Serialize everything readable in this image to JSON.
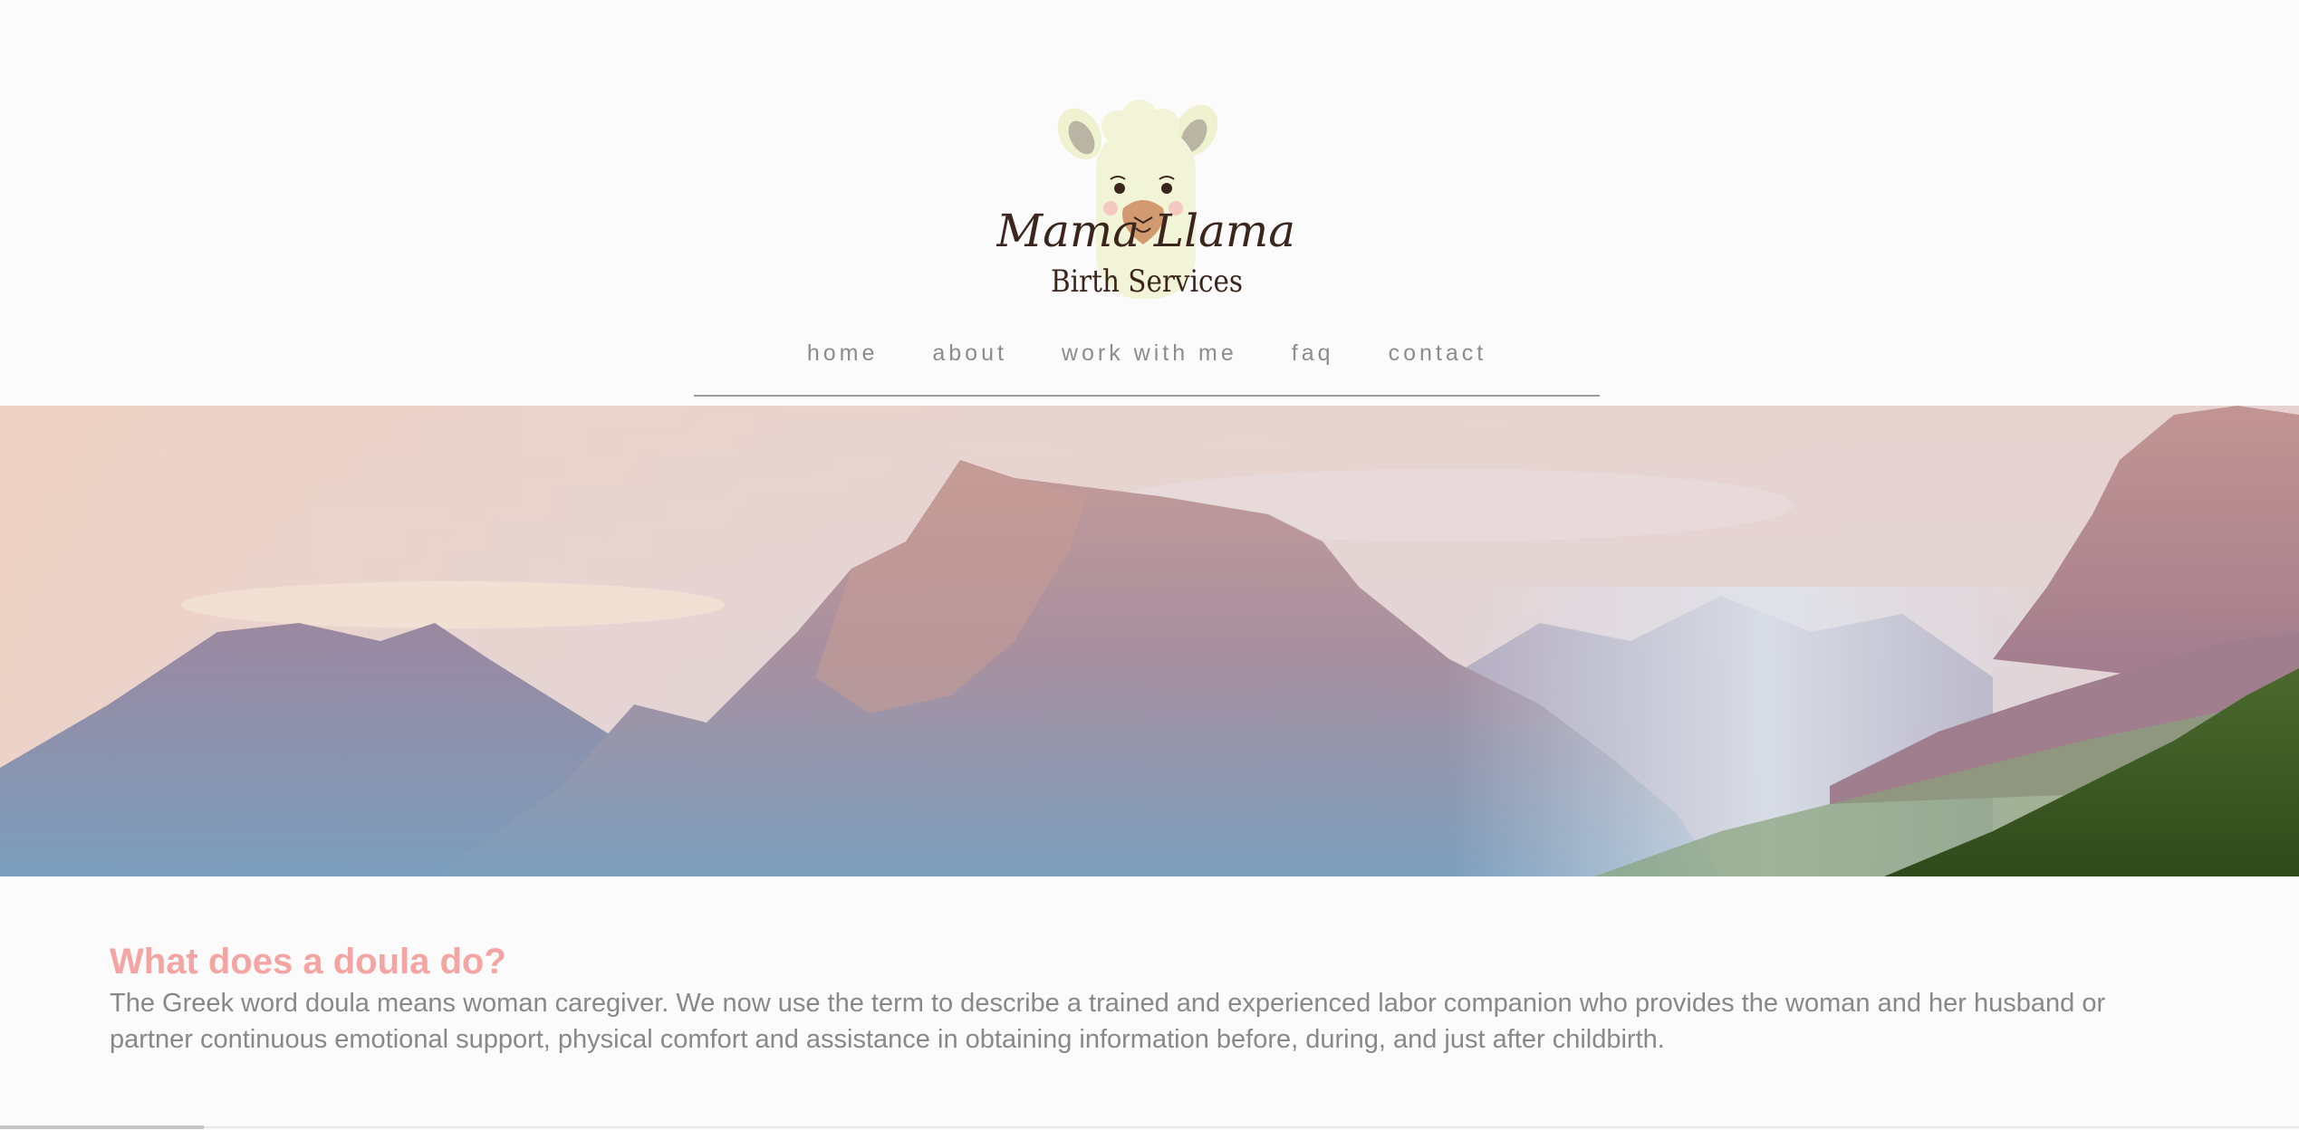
{
  "brand": {
    "line1": "Mama Llama",
    "line2": "Birth Services"
  },
  "nav": {
    "items": [
      {
        "label": "home"
      },
      {
        "label": "about"
      },
      {
        "label": "work with me"
      },
      {
        "label": "faq"
      },
      {
        "label": "contact"
      }
    ]
  },
  "hero": {
    "image": "mountain-landscape"
  },
  "section": {
    "heading": "What does a doula do?",
    "body": "The Greek word doula means woman caregiver. We now use the term to describe a trained and experienced labor companion who provides the woman and her husband or partner continuous emotional support, physical comfort and assistance in obtaining information before, during, and just after childbirth."
  },
  "colors": {
    "background": "#fbfbfb",
    "heading": "#f4a4a2",
    "body_text": "#888888",
    "nav_text": "#8c8c8c"
  }
}
